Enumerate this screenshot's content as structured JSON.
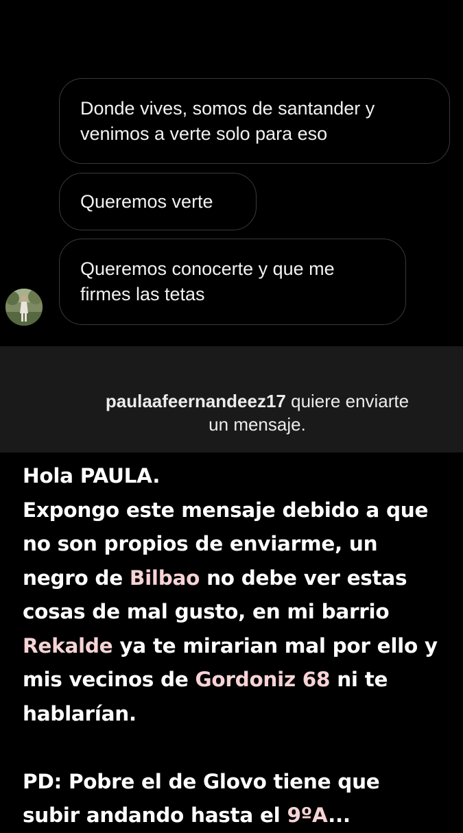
{
  "messages": [
    {
      "text": "Donde vives, somos de santander y\nvenimos a verte solo para eso"
    },
    {
      "text": "Queremos verte"
    },
    {
      "text": "Queremos conocerte y que me\nfirmes las tetas"
    }
  ],
  "request": {
    "username": "paulaafeernandeez17",
    "text_part1": " quiere enviarte",
    "text_part2": "un mensaje."
  },
  "caption": {
    "l1": "Hola PAULA.",
    "l2": "Expongo este mensaje debido a que",
    "l3": "no son propios de enviarme, un",
    "l4a": "negro de ",
    "l4b": "Bilbao",
    "l4c": " no debe ver estas",
    "l5": "cosas de mal gusto, en mi barrio",
    "l6a": "Rekalde",
    "l6b": " ya te mirarian mal por ello y",
    "l7a": "mis vecinos de ",
    "l7b": "Gordoniz 68",
    "l7c": " ni te",
    "l8": "hablarían.",
    "l9": "PD: Pobre el de Glovo tiene que",
    "l10a": "subir andando hasta el ",
    "l10b": "9ºA",
    "l10c": "..."
  },
  "colors": {
    "background": "#000000",
    "banner": "#1a1a1a",
    "bubble_border": "#3a3a3c",
    "highlight": "#f6d3d5"
  },
  "icons": {
    "avatar": "profile-photo"
  }
}
